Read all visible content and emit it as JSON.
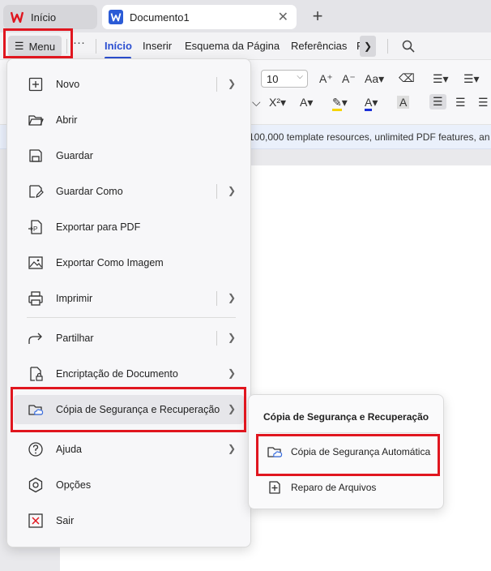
{
  "tabs": {
    "home_label": "Início",
    "doc_label": "Documento1",
    "close_glyph": "✕",
    "new_tab_glyph": "+"
  },
  "ribbon": {
    "menu_label": "Menu",
    "more_glyph": "···",
    "tabs": [
      "Início",
      "Inserir",
      "Esquema da Página",
      "Referências",
      "R"
    ],
    "active_tab": "Início"
  },
  "toolbar": {
    "font_size": "10"
  },
  "banner": {
    "text": "g 100,000 template resources, unlimited PDF features, an"
  },
  "menu": {
    "items": [
      {
        "label": "Novo",
        "icon": "new-file-icon",
        "has_submenu": true
      },
      {
        "label": "Abrir",
        "icon": "folder-open-icon",
        "has_submenu": false
      },
      {
        "label": "Guardar",
        "icon": "save-icon",
        "has_submenu": false
      },
      {
        "label": "Guardar Como",
        "icon": "save-as-icon",
        "has_submenu": true
      },
      {
        "label": "Exportar para PDF",
        "icon": "export-pdf-icon",
        "has_submenu": false
      },
      {
        "label": "Exportar Como Imagem",
        "icon": "export-image-icon",
        "has_submenu": false
      },
      {
        "label": "Imprimir",
        "icon": "print-icon",
        "has_submenu": true
      },
      {
        "label": "Partilhar",
        "icon": "share-icon",
        "has_submenu": true
      },
      {
        "label": "Encriptação de Documento",
        "icon": "encrypt-document-icon",
        "has_submenu": true
      },
      {
        "label": "Cópia de Segurança e Recuperação",
        "icon": "backup-cloud-folder-icon",
        "has_submenu": true,
        "highlighted": true
      },
      {
        "label": "Ajuda",
        "icon": "help-icon",
        "has_submenu": true
      },
      {
        "label": "Opções",
        "icon": "options-icon",
        "has_submenu": false
      },
      {
        "label": "Sair",
        "icon": "exit-icon",
        "has_submenu": false
      }
    ]
  },
  "submenu": {
    "title": "Cópia de Segurança e Recuperação",
    "items": [
      {
        "label": "Cópia de Segurança Automática",
        "icon": "backup-cloud-folder-icon"
      },
      {
        "label": "Reparo de Arquivos",
        "icon": "file-repair-icon"
      }
    ]
  },
  "colors": {
    "accent": "#2b4fd1",
    "annotation": "#e0161f",
    "wps_logo": "#e0161f",
    "word_icon": "#2b5bd6"
  }
}
